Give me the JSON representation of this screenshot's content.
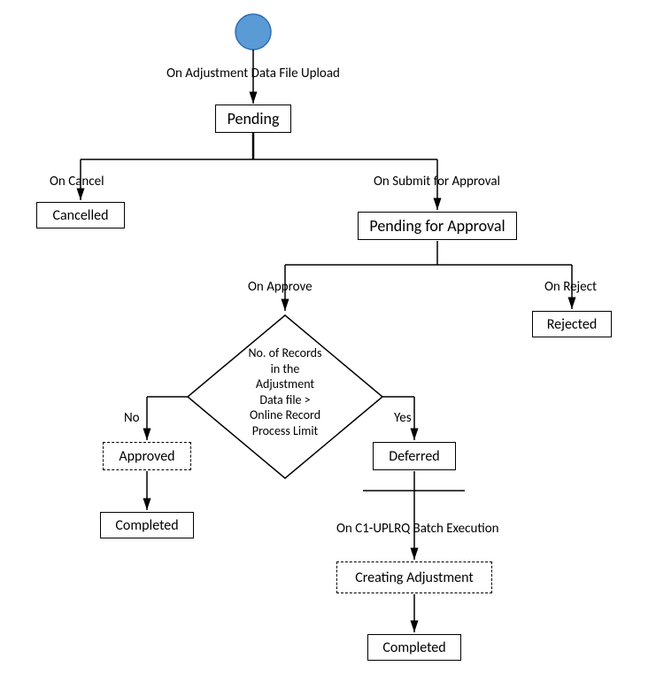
{
  "chart_data": {
    "type": "flowchart",
    "title": "",
    "start": "start",
    "nodes": [
      {
        "id": "start",
        "type": "start",
        "label": ""
      },
      {
        "id": "pending",
        "type": "process",
        "label": "Pending"
      },
      {
        "id": "cancelled",
        "type": "process",
        "label": "Cancelled"
      },
      {
        "id": "pending_approval",
        "type": "process",
        "label": "Pending for Approval"
      },
      {
        "id": "rejected",
        "type": "process",
        "label": "Rejected"
      },
      {
        "id": "decision",
        "type": "decision",
        "label": "No. of Records in the Adjustment Data file > Online Record Process Limit"
      },
      {
        "id": "approved",
        "type": "process_dashed",
        "label": "Approved"
      },
      {
        "id": "completed_left",
        "type": "process",
        "label": "Completed"
      },
      {
        "id": "deferred",
        "type": "process",
        "label": "Deferred"
      },
      {
        "id": "creating_adj",
        "type": "process_dashed",
        "label": "Creating Adjustment"
      },
      {
        "id": "completed_right",
        "type": "process",
        "label": "Completed"
      }
    ],
    "edges": [
      {
        "from": "start",
        "to": "pending",
        "label": "On Adjustment Data File Upload"
      },
      {
        "from": "pending",
        "to": "cancelled",
        "label": "On Cancel"
      },
      {
        "from": "pending",
        "to": "pending_approval",
        "label": "On Submit for Approval"
      },
      {
        "from": "pending_approval",
        "to": "rejected",
        "label": "On Reject"
      },
      {
        "from": "pending_approval",
        "to": "decision",
        "label": "On Approve"
      },
      {
        "from": "decision",
        "to": "approved",
        "label": "No"
      },
      {
        "from": "approved",
        "to": "completed_left",
        "label": ""
      },
      {
        "from": "decision",
        "to": "deferred",
        "label": "Yes"
      },
      {
        "from": "deferred",
        "to": "creating_adj",
        "label": "On C1-UPLRQ Batch Execution"
      },
      {
        "from": "creating_adj",
        "to": "completed_right",
        "label": ""
      }
    ]
  },
  "nodes": {
    "pending": "Pending",
    "cancelled": "Cancelled",
    "pending_approval": "Pending for Approval",
    "rejected": "Rejected",
    "decision_l1": "No. of Records",
    "decision_l2": "in the",
    "decision_l3": "Adjustment",
    "decision_l4": "Data file >",
    "decision_l5": "Online Record",
    "decision_l6": "Process Limit",
    "approved": "Approved",
    "completed_left": "Completed",
    "deferred": "Deferred",
    "creating_adj": "Creating Adjustment",
    "completed_right": "Completed"
  },
  "edges": {
    "upload": "On Adjustment Data File Upload",
    "cancel": "On Cancel",
    "submit": "On Submit for Approval",
    "reject": "On Reject",
    "approve": "On Approve",
    "no": "No",
    "yes": "Yes",
    "batch": "On C1-UPLRQ Batch Execution"
  }
}
